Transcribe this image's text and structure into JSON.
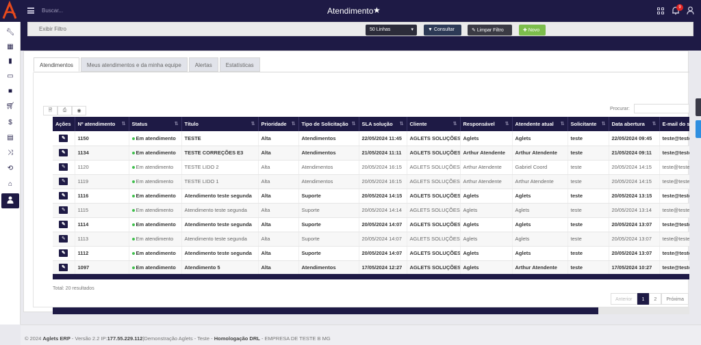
{
  "header": {
    "search_placeholder": "Buscar...",
    "title": "Atendimento",
    "notification_count": "9"
  },
  "sidebar": {
    "items": [
      {
        "icon": "wrench-icon"
      },
      {
        "icon": "calculator-icon"
      },
      {
        "icon": "book-icon"
      },
      {
        "icon": "money-icon"
      },
      {
        "icon": "briefcase-icon"
      },
      {
        "icon": "cart-icon"
      },
      {
        "icon": "dollar-icon"
      },
      {
        "icon": "table-icon"
      },
      {
        "icon": "shuffle-icon"
      },
      {
        "icon": "retweet-icon"
      },
      {
        "icon": "bank-icon"
      },
      {
        "icon": "user-icon",
        "active": true
      }
    ]
  },
  "filterbar": {
    "show_filter_label": "Exibir Filtro",
    "lines_select": "50 Linhas",
    "consultar_label": "Consultar",
    "limpar_label": "Limpar Filtro",
    "novo_label": "Novo"
  },
  "tabs": [
    "Atendimentos",
    "Meus atendimentos e da minha equipe",
    "Alertas",
    "Estatísticas"
  ],
  "table": {
    "search_label": "Procurar:",
    "columns": [
      "Ações",
      "Nº atendimento",
      "Status",
      "Título",
      "Prioridade",
      "Tipo de Solicitação",
      "SLA solução",
      "Cliente",
      "Responsável",
      "Atendente atual",
      "Solicitante",
      "Data abertura",
      "E-mail do so"
    ],
    "rows": [
      {
        "bold": true,
        "cells": [
          "1150",
          "Em atendimento",
          "TESTE",
          "Alta",
          "Atendimentos",
          "22/05/2024 11:45",
          "AGLETS SOLUÇÕES",
          "Aglets",
          "Aglets",
          "teste",
          "22/05/2024 09:45",
          "teste@teste"
        ]
      },
      {
        "bold": true,
        "cells": [
          "1134",
          "Em atendimento",
          "TESTE CORREÇÕES E3",
          "Alta",
          "Atendimentos",
          "21/05/2024 11:11",
          "AGLETS SOLUÇÕES",
          "Arthur Atendente",
          "Arthur Atendente",
          "teste",
          "21/05/2024 09:11",
          "teste@teste"
        ]
      },
      {
        "bold": false,
        "cells": [
          "1120",
          "Em atendimento",
          "TESTE LIDO 2",
          "Alta",
          "Atendimentos",
          "20/05/2024 16:15",
          "AGLETS SOLUÇÕES",
          "Arthur Atendente",
          "Gabriel Coord",
          "teste",
          "20/05/2024 14:15",
          "teste@teste."
        ]
      },
      {
        "bold": false,
        "cells": [
          "1119",
          "Em atendimento",
          "TESTE LIDO 1",
          "Alta",
          "Atendimentos",
          "20/05/2024 16:15",
          "AGLETS SOLUÇÕES",
          "Arthur Atendente",
          "Arthur Atendente",
          "teste",
          "20/05/2024 14:15",
          "teste@teste."
        ]
      },
      {
        "bold": true,
        "cells": [
          "1116",
          "Em atendimento",
          "Atendimento teste segunda",
          "Alta",
          "Suporte",
          "20/05/2024 14:15",
          "AGLETS SOLUÇÕES",
          "Aglets",
          "Aglets",
          "teste",
          "20/05/2024 13:15",
          "teste@teste"
        ]
      },
      {
        "bold": false,
        "cells": [
          "1115",
          "Em atendimento",
          "Atendimento teste segunda",
          "Alta",
          "Suporte",
          "20/05/2024 14:14",
          "AGLETS SOLUÇÕES",
          "Aglets",
          "Aglets",
          "teste",
          "20/05/2024 13:14",
          "teste@teste."
        ]
      },
      {
        "bold": true,
        "cells": [
          "1114",
          "Em atendimento",
          "Atendimento teste segunda",
          "Alta",
          "Suporte",
          "20/05/2024 14:07",
          "AGLETS SOLUÇÕES",
          "Aglets",
          "Aglets",
          "teste",
          "20/05/2024 13:07",
          "teste@teste"
        ]
      },
      {
        "bold": false,
        "cells": [
          "1113",
          "Em atendimento",
          "Atendimento teste segunda",
          "Alta",
          "Suporte",
          "20/05/2024 14:07",
          "AGLETS SOLUÇÕES",
          "Aglets",
          "Aglets",
          "teste",
          "20/05/2024 13:07",
          "teste@teste."
        ]
      },
      {
        "bold": true,
        "cells": [
          "1112",
          "Em atendimento",
          "Atendimento teste segunda",
          "Alta",
          "Suporte",
          "20/05/2024 14:07",
          "AGLETS SOLUÇÕES",
          "Aglets",
          "Aglets",
          "teste",
          "20/05/2024 13:07",
          "teste@teste"
        ]
      },
      {
        "bold": true,
        "cells": [
          "1097",
          "Em atendimento",
          "Atendimento 5",
          "Alta",
          "Atendimentos",
          "17/05/2024 12:27",
          "AGLETS SOLUÇÕES",
          "Aglets",
          "Arthur Atendente",
          "teste",
          "17/05/2024 10:27",
          "teste@teste"
        ]
      }
    ],
    "total_text": "Total: 20 resultados"
  },
  "pagination": {
    "prev": "Anterior",
    "pages": [
      "1",
      "2"
    ],
    "current": "1",
    "next": "Próxima"
  },
  "progress_fraction": 0.857,
  "footer": {
    "copyright": "© 2024",
    "app": "Aglets ERP",
    "version": "- Versão 2.2",
    "ip_label": "IP:",
    "ip": "177.55.229.112",
    "env": "|Demonstração Aglets - Teste -",
    "homolog": "Homologação DRL",
    "company": "- EMPRESA DE TESTE B MG"
  },
  "colors": {
    "navy": "#1e1a45",
    "green": "#7cbd4c",
    "status_dot": "#3fbf4c",
    "badge": "#e02424"
  }
}
